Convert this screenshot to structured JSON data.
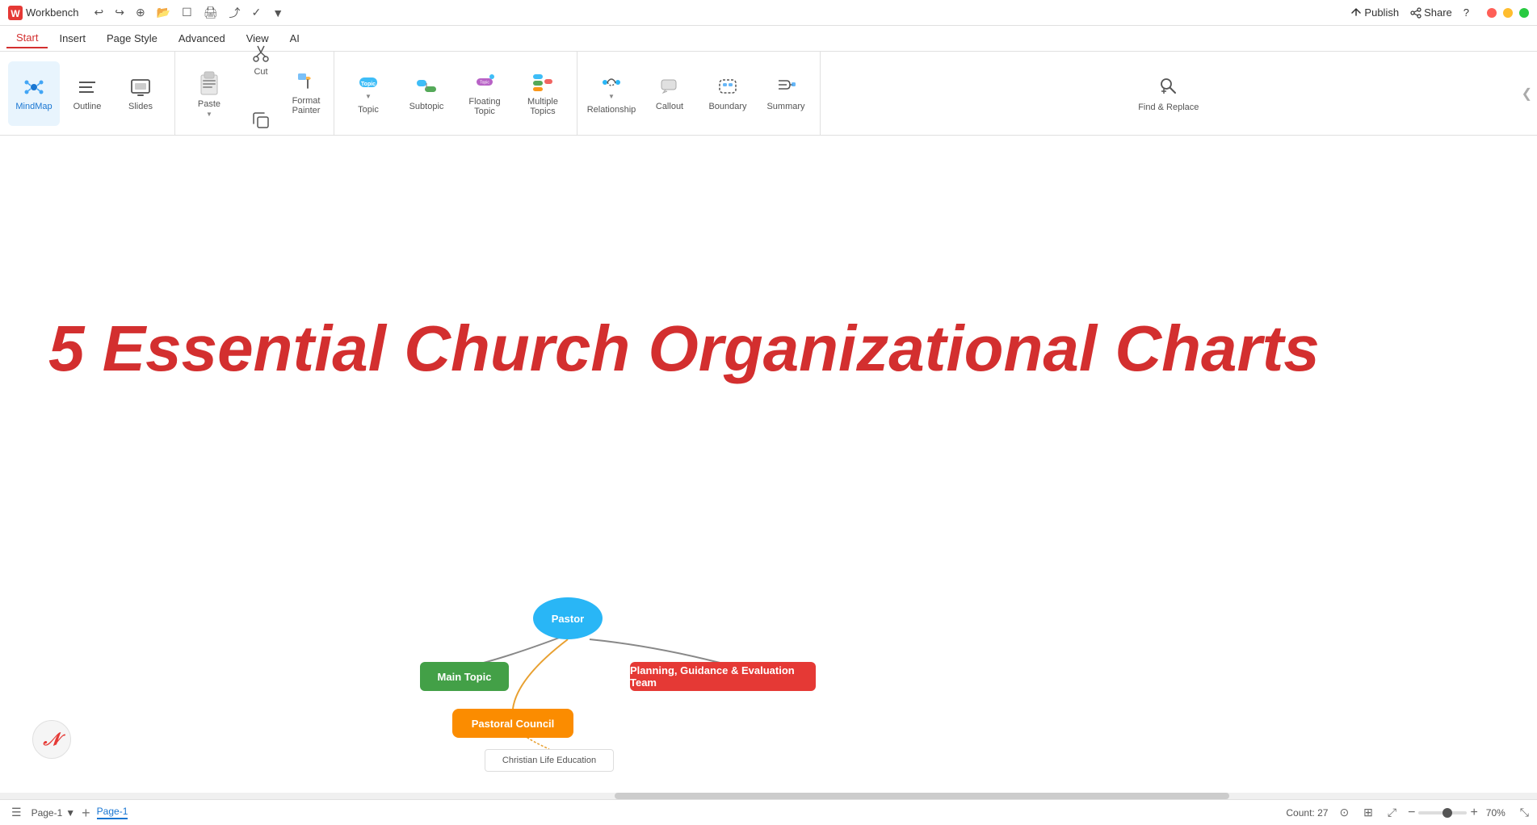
{
  "titleBar": {
    "appName": "Workbench",
    "publishLabel": "Publish",
    "shareLabel": "Share",
    "helpLabel": "?"
  },
  "menuBar": {
    "items": [
      {
        "id": "start",
        "label": "Start",
        "active": true
      },
      {
        "id": "insert",
        "label": "Insert",
        "active": false
      },
      {
        "id": "pageStyle",
        "label": "Page Style",
        "active": false
      },
      {
        "id": "advanced",
        "label": "Advanced",
        "active": false
      },
      {
        "id": "view",
        "label": "View",
        "active": false
      },
      {
        "id": "ai",
        "label": "AI",
        "active": false
      }
    ]
  },
  "toolbar": {
    "views": [
      {
        "id": "mindmap",
        "label": "MindMap",
        "active": true
      },
      {
        "id": "outline",
        "label": "Outline",
        "active": false
      },
      {
        "id": "slides",
        "label": "Slides",
        "active": false
      }
    ],
    "clipboardTools": [
      {
        "id": "paste",
        "label": "Paste"
      },
      {
        "id": "cut",
        "label": "Cut"
      },
      {
        "id": "copy",
        "label": "Copy"
      },
      {
        "id": "formatPainter",
        "label": "Format Painter"
      }
    ],
    "insertTools": [
      {
        "id": "topic",
        "label": "Topic"
      },
      {
        "id": "subtopic",
        "label": "Subtopic"
      },
      {
        "id": "floatingTopic",
        "label": "Floating Topic"
      },
      {
        "id": "multipleTopics",
        "label": "Multiple Topics"
      }
    ],
    "relationshipTools": [
      {
        "id": "relationship",
        "label": "Relationship"
      },
      {
        "id": "callout",
        "label": "Callout"
      },
      {
        "id": "boundary",
        "label": "Boundary"
      },
      {
        "id": "summary",
        "label": "Summary"
      }
    ],
    "findReplace": {
      "id": "findReplace",
      "label": "Find & Replace"
    }
  },
  "canvas": {
    "mainTitle": "5 Essential Church Organizational Charts"
  },
  "mindmap": {
    "nodes": [
      {
        "id": "pastor",
        "label": "Pastor"
      },
      {
        "id": "mainTopic",
        "label": "Main Topic"
      },
      {
        "id": "planning",
        "label": "Planning, Guidance & Evaluation Team"
      },
      {
        "id": "pastoral",
        "label": "Pastoral Council"
      },
      {
        "id": "christian",
        "label": "Christian Life Education"
      }
    ]
  },
  "bottomBar": {
    "pages": [
      {
        "id": "page1",
        "label": "Page-1",
        "active": true
      }
    ],
    "activePageLabel": "Page-1",
    "countLabel": "Count: 27",
    "zoomLevel": "70%",
    "addPageTitle": "+"
  },
  "icons": {
    "workbenchIcon": "⚙",
    "collapseIcon": "❮"
  }
}
